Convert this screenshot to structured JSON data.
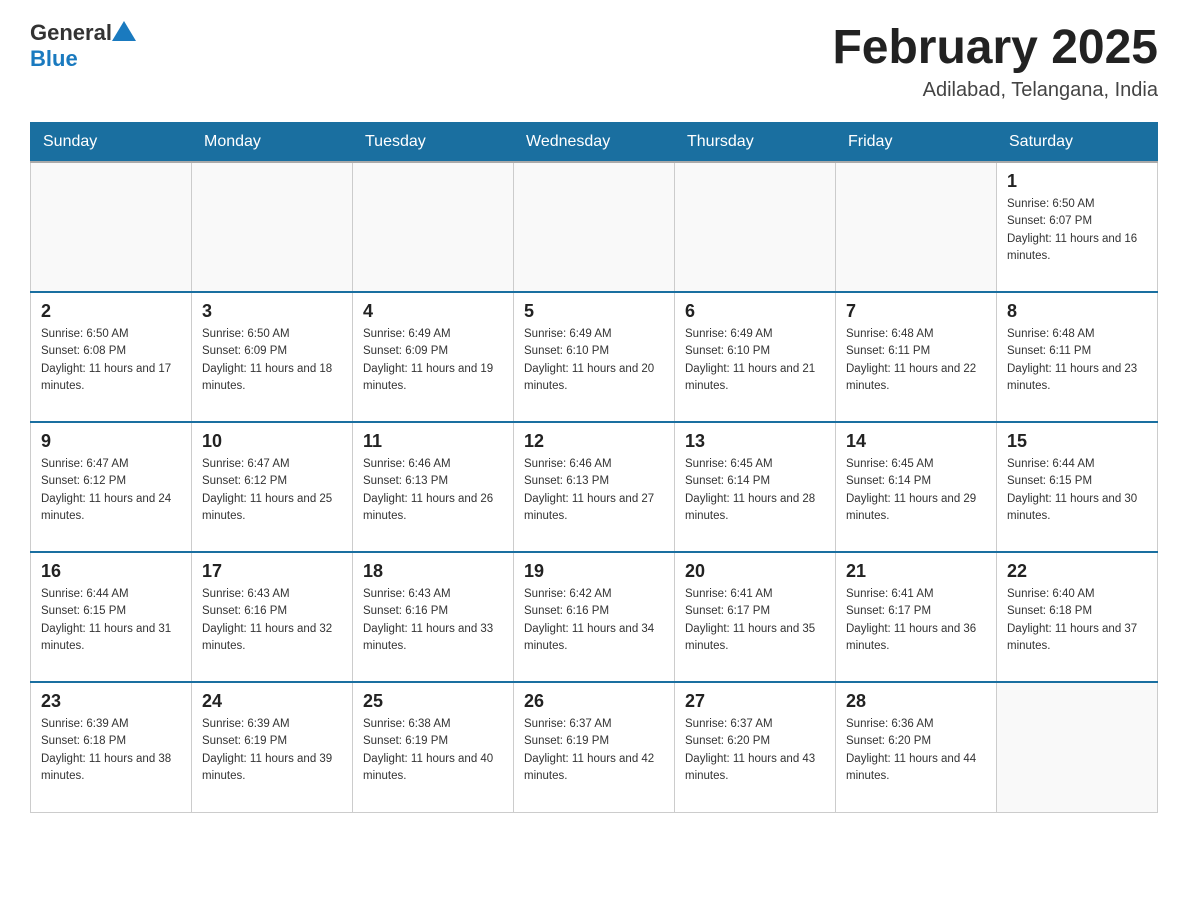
{
  "header": {
    "logo": {
      "text_general": "General",
      "text_blue": "Blue"
    },
    "title": "February 2025",
    "location": "Adilabad, Telangana, India"
  },
  "days_of_week": [
    "Sunday",
    "Monday",
    "Tuesday",
    "Wednesday",
    "Thursday",
    "Friday",
    "Saturday"
  ],
  "weeks": [
    [
      {
        "day": "",
        "info": ""
      },
      {
        "day": "",
        "info": ""
      },
      {
        "day": "",
        "info": ""
      },
      {
        "day": "",
        "info": ""
      },
      {
        "day": "",
        "info": ""
      },
      {
        "day": "",
        "info": ""
      },
      {
        "day": "1",
        "info": "Sunrise: 6:50 AM\nSunset: 6:07 PM\nDaylight: 11 hours and 16 minutes."
      }
    ],
    [
      {
        "day": "2",
        "info": "Sunrise: 6:50 AM\nSunset: 6:08 PM\nDaylight: 11 hours and 17 minutes."
      },
      {
        "day": "3",
        "info": "Sunrise: 6:50 AM\nSunset: 6:09 PM\nDaylight: 11 hours and 18 minutes."
      },
      {
        "day": "4",
        "info": "Sunrise: 6:49 AM\nSunset: 6:09 PM\nDaylight: 11 hours and 19 minutes."
      },
      {
        "day": "5",
        "info": "Sunrise: 6:49 AM\nSunset: 6:10 PM\nDaylight: 11 hours and 20 minutes."
      },
      {
        "day": "6",
        "info": "Sunrise: 6:49 AM\nSunset: 6:10 PM\nDaylight: 11 hours and 21 minutes."
      },
      {
        "day": "7",
        "info": "Sunrise: 6:48 AM\nSunset: 6:11 PM\nDaylight: 11 hours and 22 minutes."
      },
      {
        "day": "8",
        "info": "Sunrise: 6:48 AM\nSunset: 6:11 PM\nDaylight: 11 hours and 23 minutes."
      }
    ],
    [
      {
        "day": "9",
        "info": "Sunrise: 6:47 AM\nSunset: 6:12 PM\nDaylight: 11 hours and 24 minutes."
      },
      {
        "day": "10",
        "info": "Sunrise: 6:47 AM\nSunset: 6:12 PM\nDaylight: 11 hours and 25 minutes."
      },
      {
        "day": "11",
        "info": "Sunrise: 6:46 AM\nSunset: 6:13 PM\nDaylight: 11 hours and 26 minutes."
      },
      {
        "day": "12",
        "info": "Sunrise: 6:46 AM\nSunset: 6:13 PM\nDaylight: 11 hours and 27 minutes."
      },
      {
        "day": "13",
        "info": "Sunrise: 6:45 AM\nSunset: 6:14 PM\nDaylight: 11 hours and 28 minutes."
      },
      {
        "day": "14",
        "info": "Sunrise: 6:45 AM\nSunset: 6:14 PM\nDaylight: 11 hours and 29 minutes."
      },
      {
        "day": "15",
        "info": "Sunrise: 6:44 AM\nSunset: 6:15 PM\nDaylight: 11 hours and 30 minutes."
      }
    ],
    [
      {
        "day": "16",
        "info": "Sunrise: 6:44 AM\nSunset: 6:15 PM\nDaylight: 11 hours and 31 minutes."
      },
      {
        "day": "17",
        "info": "Sunrise: 6:43 AM\nSunset: 6:16 PM\nDaylight: 11 hours and 32 minutes."
      },
      {
        "day": "18",
        "info": "Sunrise: 6:43 AM\nSunset: 6:16 PM\nDaylight: 11 hours and 33 minutes."
      },
      {
        "day": "19",
        "info": "Sunrise: 6:42 AM\nSunset: 6:16 PM\nDaylight: 11 hours and 34 minutes."
      },
      {
        "day": "20",
        "info": "Sunrise: 6:41 AM\nSunset: 6:17 PM\nDaylight: 11 hours and 35 minutes."
      },
      {
        "day": "21",
        "info": "Sunrise: 6:41 AM\nSunset: 6:17 PM\nDaylight: 11 hours and 36 minutes."
      },
      {
        "day": "22",
        "info": "Sunrise: 6:40 AM\nSunset: 6:18 PM\nDaylight: 11 hours and 37 minutes."
      }
    ],
    [
      {
        "day": "23",
        "info": "Sunrise: 6:39 AM\nSunset: 6:18 PM\nDaylight: 11 hours and 38 minutes."
      },
      {
        "day": "24",
        "info": "Sunrise: 6:39 AM\nSunset: 6:19 PM\nDaylight: 11 hours and 39 minutes."
      },
      {
        "day": "25",
        "info": "Sunrise: 6:38 AM\nSunset: 6:19 PM\nDaylight: 11 hours and 40 minutes."
      },
      {
        "day": "26",
        "info": "Sunrise: 6:37 AM\nSunset: 6:19 PM\nDaylight: 11 hours and 42 minutes."
      },
      {
        "day": "27",
        "info": "Sunrise: 6:37 AM\nSunset: 6:20 PM\nDaylight: 11 hours and 43 minutes."
      },
      {
        "day": "28",
        "info": "Sunrise: 6:36 AM\nSunset: 6:20 PM\nDaylight: 11 hours and 44 minutes."
      },
      {
        "day": "",
        "info": ""
      }
    ]
  ]
}
